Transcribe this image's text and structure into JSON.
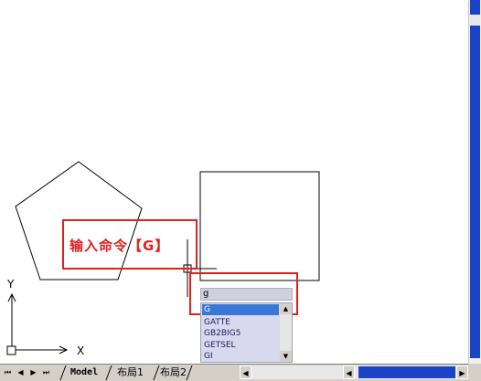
{
  "annotation": {
    "text": "输入命令【G】"
  },
  "command_line": {
    "value": "g"
  },
  "autocomplete": {
    "items": [
      {
        "label": "G",
        "selected": true
      },
      {
        "label": "GATTE",
        "selected": false
      },
      {
        "label": "GB2BIG5",
        "selected": false
      },
      {
        "label": "GETSEL",
        "selected": false
      },
      {
        "label": "GI",
        "selected": false
      }
    ]
  },
  "ucs": {
    "x_label": "X",
    "y_label": "Y"
  },
  "layout_tabs": [
    {
      "label": "Model",
      "active": true
    },
    {
      "label": "布局1",
      "active": false
    },
    {
      "label": "布局2",
      "active": false
    }
  ],
  "nav": {
    "first": "⏮",
    "prev": "◀",
    "next": "▶",
    "last": "⏭"
  },
  "colors": {
    "accent_red": "#e02020",
    "scroll_blue": "#1a43c6",
    "selection": "#3a78d8"
  }
}
